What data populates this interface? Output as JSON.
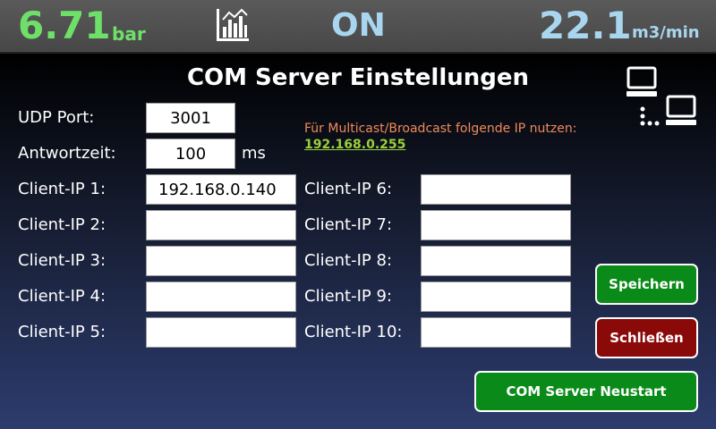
{
  "header": {
    "pressure_value": "6.71",
    "pressure_unit": "bar",
    "chart_icon": "bar-chart-icon",
    "status": "ON",
    "flow_value": "22.1",
    "flow_unit": "m3/min"
  },
  "page": {
    "title": "COM Server Einstellungen",
    "network_icon": "network-computers-icon"
  },
  "settings": {
    "udp_port_label": "UDP Port:",
    "udp_port_value": "3001",
    "response_time_label": "Antwortzeit:",
    "response_time_value": "100",
    "response_time_unit": "ms"
  },
  "hint": {
    "text": "Für Multicast/Broadcast folgende IP nutzen:",
    "ip": "192.168.0.255"
  },
  "clients": [
    {
      "label": "Client-IP 1:",
      "value": "192.168.0.140"
    },
    {
      "label": "Client-IP 2:",
      "value": ""
    },
    {
      "label": "Client-IP 3:",
      "value": ""
    },
    {
      "label": "Client-IP 4:",
      "value": ""
    },
    {
      "label": "Client-IP 5:",
      "value": ""
    },
    {
      "label": "Client-IP 6:",
      "value": ""
    },
    {
      "label": "Client-IP 7:",
      "value": ""
    },
    {
      "label": "Client-IP 8:",
      "value": ""
    },
    {
      "label": "Client-IP 9:",
      "value": ""
    },
    {
      "label": "Client-IP 10:",
      "value": ""
    }
  ],
  "buttons": {
    "save": "Speichern",
    "close": "Schließen",
    "restart": "COM Server Neustart"
  },
  "colors": {
    "pressure": "#6ee06a",
    "flow_status": "#a9d6ef",
    "hint": "#ef8a5a",
    "hint_ip": "#9ccf3c",
    "button_green": "#0a8a18",
    "button_red": "#8a0a0a"
  }
}
